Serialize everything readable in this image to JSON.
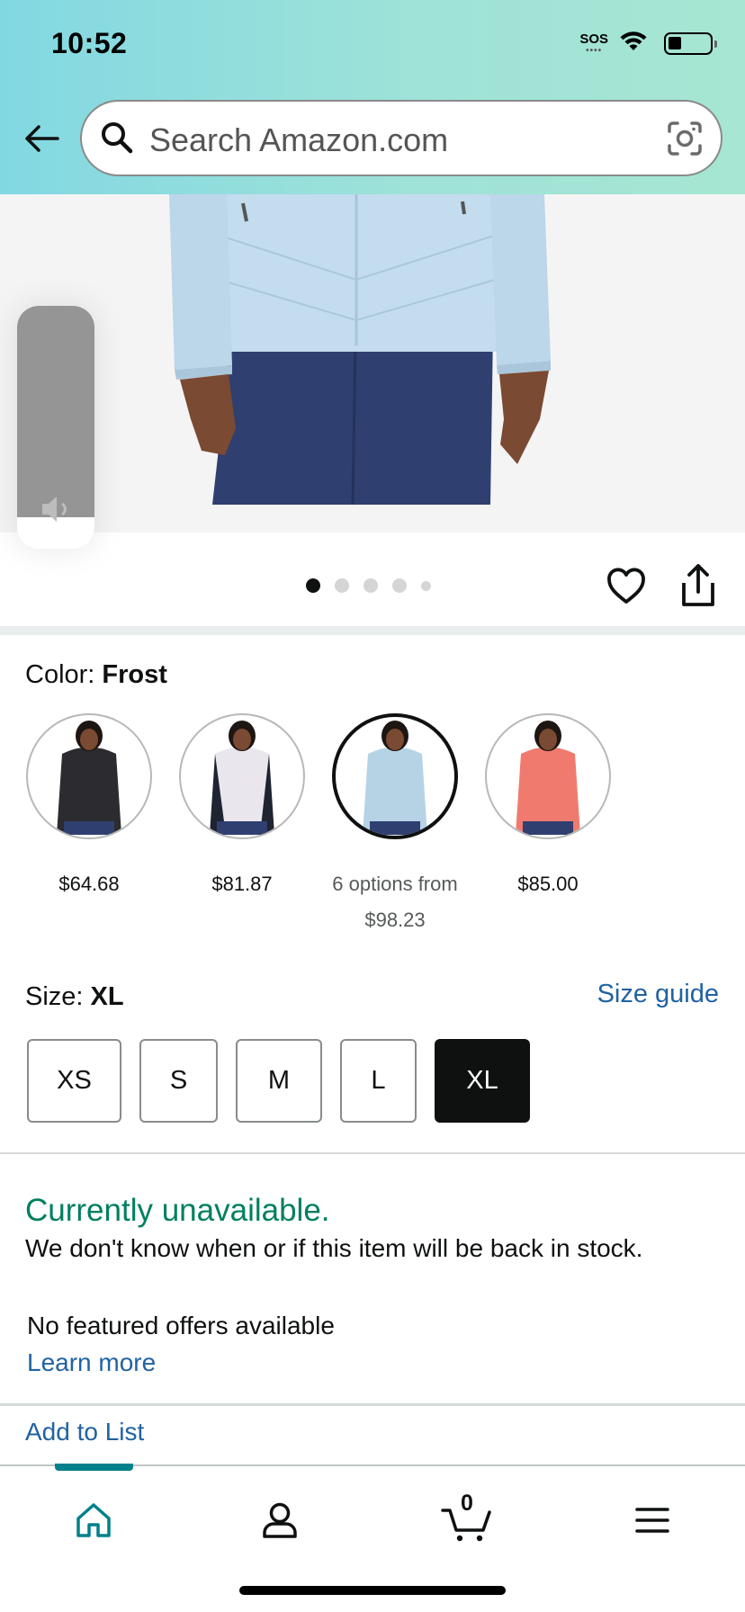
{
  "status_bar": {
    "time": "10:52",
    "sos": "SOS"
  },
  "search": {
    "placeholder": "Search Amazon.com"
  },
  "gallery": {
    "image_count": 5,
    "active_index": 0,
    "volume_level": 0.87
  },
  "color": {
    "label": "Color: ",
    "selected": "Frost",
    "options": [
      {
        "name": "Black",
        "price": "$64.68",
        "swatch": "#2b2b30"
      },
      {
        "name": "White",
        "price": "$81.87",
        "swatch": "#e9e6ee"
      },
      {
        "name": "Frost",
        "price_line1": "6 options from",
        "price_line2": "$98.23",
        "swatch": "#b6d3e6"
      },
      {
        "name": "Coral",
        "price": "$85.00",
        "swatch": "#f07a6e"
      }
    ]
  },
  "size": {
    "label": "Size: ",
    "selected": "XL",
    "guide_label": "Size guide",
    "options": [
      "XS",
      "S",
      "M",
      "L",
      "XL"
    ]
  },
  "availability": {
    "status": "Currently unavailable.",
    "message": "We don't know when or if this item will be back in stock.",
    "no_offers": "No featured offers available",
    "learn_more": "Learn more"
  },
  "actions": {
    "add_to_list": "Add to List"
  },
  "nav": {
    "cart_count": "0"
  },
  "colors": {
    "accent_teal": "#00808b",
    "link_blue": "#2162a1",
    "unavailable_green": "#007f5f"
  }
}
